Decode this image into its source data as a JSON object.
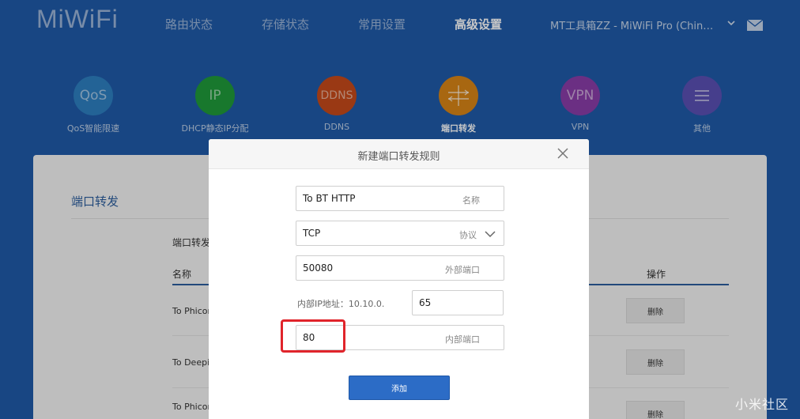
{
  "header": {
    "logo": "MiWiFi",
    "nav": [
      "路由状态",
      "存储状态",
      "常用设置",
      "高级设置"
    ],
    "active_nav": "高级设置",
    "device": "MT工具箱ZZ - MiWiFi Pro (China Unicom)"
  },
  "functions": [
    {
      "icon_text": "QoS",
      "label": "QoS智能限速",
      "color": "#2e7fc0"
    },
    {
      "icon_text": "IP",
      "label": "DHCP静态IP分配",
      "color": "#1f9a3a"
    },
    {
      "icon_text": "DDNS",
      "label": "DDNS",
      "color": "#c64a1a"
    },
    {
      "icon_text": "",
      "label": "端口转发",
      "color": "#d88416"
    },
    {
      "icon_text": "VPN",
      "label": "VPN",
      "color": "#8a3da8"
    },
    {
      "icon_text": "",
      "label": "其他",
      "color": "#5a50b4"
    }
  ],
  "panel": {
    "title": "端口转发",
    "subtitle": "端口转发",
    "col_name": "名称",
    "col_action": "操作",
    "rows": [
      {
        "name": "To Phicom",
        "delete": "删除"
      },
      {
        "name": "To Deepin",
        "delete": "删除"
      },
      {
        "name": "To Phicom",
        "delete": "删除"
      }
    ]
  },
  "modal": {
    "title": "新建端口转发规则",
    "name_value": "To BT HTTP",
    "name_hint": "名称",
    "protocol_value": "TCP",
    "protocol_hint": "协议",
    "external_port_value": "50080",
    "external_port_hint": "外部端口",
    "internal_ip_label": "内部IP地址：10.10.0.",
    "internal_ip_last": "65",
    "internal_port_value": "80",
    "internal_port_hint": "内部端口",
    "add_button": "添加"
  },
  "watermark": "小米社区",
  "icons": {
    "close": "close-icon",
    "chevron": "chevron-down-icon",
    "mail": "mail-icon",
    "port_forward": "port-forward-icon",
    "menu": "menu-icon"
  }
}
